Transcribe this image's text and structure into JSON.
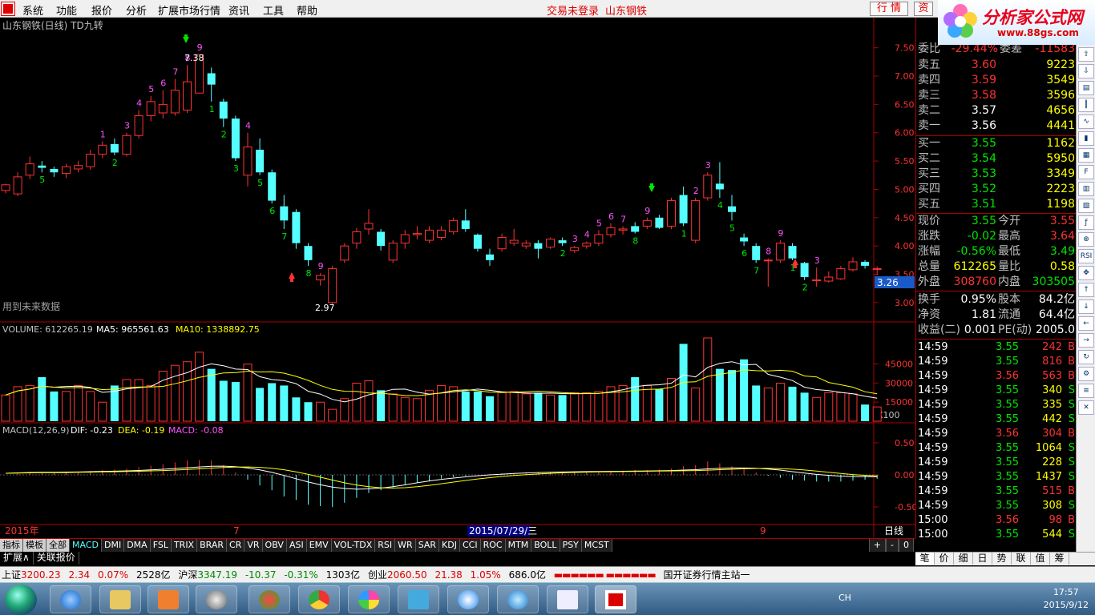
{
  "menu": {
    "items": [
      "系统",
      "功能",
      "报价",
      "分析",
      "扩展市场行情",
      "资讯",
      "工具",
      "帮助"
    ],
    "status_login": "交易未登录",
    "status_stock": "山东钢铁",
    "btn_quote": "行 情",
    "btn_trade": "资"
  },
  "brand": {
    "name": "分析家公式网",
    "url": "www.88gs.com"
  },
  "price_panel": {
    "title": "山东钢铁(日线) TD九转",
    "future_note": "用到未来数据",
    "y_ticks": [
      "7.50",
      "7.00",
      "6.50",
      "6.00",
      "5.50",
      "5.00",
      "4.50",
      "4.00",
      "3.50",
      "3.00"
    ],
    "current_price_tag": "3.26",
    "high_label": "7.38",
    "low_label": "2.97"
  },
  "volume_panel": {
    "label_vol": "VOLUME: 612265.19",
    "label_ma5": "MA5: 965561.63",
    "label_ma10": "MA10: 1338892.75",
    "y_ticks": [
      "45000",
      "30000",
      "15000"
    ],
    "multiplier": "X100"
  },
  "macd_panel": {
    "label_macd": "MACD(12,26,9)",
    "label_dif": "DIF: -0.23",
    "label_dea": "DEA: -0.19",
    "label_val": "MACD: -0.08",
    "y_ticks": [
      "0.50",
      "0.00",
      "-0.50"
    ]
  },
  "date_axis": {
    "year": "2015年",
    "m7": "7",
    "cursor_date": "2015/07/29/三",
    "m9": "9",
    "period": "日线"
  },
  "chart_data": {
    "type": "candlestick",
    "price_range": [
      2.8,
      7.75
    ],
    "candles": [
      {
        "o": 4.98,
        "c": 5.08,
        "h": 5.1,
        "l": 4.93
      },
      {
        "o": 4.92,
        "c": 5.22,
        "h": 5.3,
        "l": 4.88
      },
      {
        "o": 5.25,
        "c": 5.45,
        "h": 5.58,
        "l": 5.18
      },
      {
        "o": 5.42,
        "c": 5.38,
        "h": 5.5,
        "l": 5.3
      },
      {
        "o": 5.36,
        "c": 5.3,
        "h": 5.4,
        "l": 5.22
      },
      {
        "o": 5.28,
        "c": 5.4,
        "h": 5.45,
        "l": 5.2
      },
      {
        "o": 5.36,
        "c": 5.42,
        "h": 5.5,
        "l": 5.3
      },
      {
        "o": 5.4,
        "c": 5.62,
        "h": 5.7,
        "l": 5.35
      },
      {
        "o": 5.62,
        "c": 5.78,
        "h": 5.85,
        "l": 5.55
      },
      {
        "o": 5.8,
        "c": 5.65,
        "h": 5.9,
        "l": 5.6
      },
      {
        "o": 5.62,
        "c": 5.95,
        "h": 6.0,
        "l": 5.58
      },
      {
        "o": 5.95,
        "c": 6.3,
        "h": 6.4,
        "l": 5.9
      },
      {
        "o": 6.3,
        "c": 6.55,
        "h": 6.65,
        "l": 6.2
      },
      {
        "o": 6.35,
        "c": 6.5,
        "h": 6.75,
        "l": 6.25
      },
      {
        "o": 6.35,
        "c": 6.75,
        "h": 6.95,
        "l": 6.3
      },
      {
        "o": 6.4,
        "c": 6.9,
        "h": 7.2,
        "l": 6.35
      },
      {
        "o": 6.7,
        "c": 7.38,
        "h": 7.38,
        "l": 6.7
      },
      {
        "o": 7.05,
        "c": 6.85,
        "h": 7.15,
        "l": 6.55
      },
      {
        "o": 6.55,
        "c": 6.25,
        "h": 6.6,
        "l": 6.1
      },
      {
        "o": 6.25,
        "c": 5.55,
        "h": 6.3,
        "l": 5.5
      },
      {
        "o": 5.25,
        "c": 5.75,
        "h": 6.0,
        "l": 5.05
      },
      {
        "o": 5.7,
        "c": 5.3,
        "h": 5.9,
        "l": 5.25
      },
      {
        "o": 5.3,
        "c": 4.8,
        "h": 5.35,
        "l": 4.75
      },
      {
        "o": 4.7,
        "c": 4.45,
        "h": 4.9,
        "l": 4.3
      },
      {
        "o": 4.6,
        "c": 4.05,
        "h": 4.65,
        "l": 3.95
      },
      {
        "o": 4.0,
        "c": 3.75,
        "h": 4.05,
        "l": 3.65
      },
      {
        "o": 3.4,
        "c": 3.48,
        "h": 3.52,
        "l": 3.3
      },
      {
        "o": 3.0,
        "c": 3.6,
        "h": 3.65,
        "l": 2.97
      },
      {
        "o": 3.75,
        "c": 4.0,
        "h": 4.05,
        "l": 3.7
      },
      {
        "o": 4.05,
        "c": 4.25,
        "h": 4.32,
        "l": 3.95
      },
      {
        "o": 4.3,
        "c": 4.4,
        "h": 4.65,
        "l": 4.2
      },
      {
        "o": 4.25,
        "c": 4.0,
        "h": 4.3,
        "l": 3.92
      },
      {
        "o": 3.75,
        "c": 4.05,
        "h": 4.1,
        "l": 3.7
      },
      {
        "o": 4.05,
        "c": 4.2,
        "h": 4.28,
        "l": 3.95
      },
      {
        "o": 4.2,
        "c": 4.22,
        "h": 4.35,
        "l": 4.12
      },
      {
        "o": 4.1,
        "c": 4.28,
        "h": 4.35,
        "l": 4.05
      },
      {
        "o": 4.15,
        "c": 4.28,
        "h": 4.35,
        "l": 4.1
      },
      {
        "o": 4.25,
        "c": 4.45,
        "h": 4.5,
        "l": 4.2
      },
      {
        "o": 4.45,
        "c": 4.3,
        "h": 4.65,
        "l": 4.25
      },
      {
        "o": 4.2,
        "c": 3.95,
        "h": 4.22,
        "l": 3.9
      },
      {
        "o": 3.85,
        "c": 3.75,
        "h": 3.95,
        "l": 3.65
      },
      {
        "o": 3.95,
        "c": 4.15,
        "h": 4.22,
        "l": 3.9
      },
      {
        "o": 4.05,
        "c": 4.1,
        "h": 4.3,
        "l": 4.0
      },
      {
        "o": 4.0,
        "c": 4.05,
        "h": 4.1,
        "l": 3.95
      },
      {
        "o": 4.05,
        "c": 3.95,
        "h": 4.1,
        "l": 3.78
      },
      {
        "o": 3.98,
        "c": 4.12,
        "h": 4.15,
        "l": 3.95
      },
      {
        "o": 4.1,
        "c": 4.05,
        "h": 4.15,
        "l": 4.0
      },
      {
        "o": 3.92,
        "c": 3.97,
        "h": 4.0,
        "l": 3.88
      },
      {
        "o": 4.0,
        "c": 4.05,
        "h": 4.08,
        "l": 3.95
      },
      {
        "o": 4.05,
        "c": 4.2,
        "h": 4.28,
        "l": 4.0
      },
      {
        "o": 4.2,
        "c": 4.32,
        "h": 4.4,
        "l": 4.15
      },
      {
        "o": 4.28,
        "c": 4.3,
        "h": 4.35,
        "l": 4.2
      },
      {
        "o": 4.35,
        "c": 4.25,
        "h": 4.42,
        "l": 4.22
      },
      {
        "o": 4.35,
        "c": 4.45,
        "h": 4.5,
        "l": 4.3
      },
      {
        "o": 4.5,
        "c": 4.32,
        "h": 4.55,
        "l": 4.3
      },
      {
        "o": 4.35,
        "c": 4.8,
        "h": 4.85,
        "l": 4.3
      },
      {
        "o": 4.9,
        "c": 4.4,
        "h": 5.05,
        "l": 4.35
      },
      {
        "o": 4.1,
        "c": 4.8,
        "h": 4.85,
        "l": 4.05
      },
      {
        "o": 4.85,
        "c": 5.25,
        "h": 5.3,
        "l": 4.8
      },
      {
        "o": 5.1,
        "c": 5.0,
        "h": 5.48,
        "l": 4.85
      },
      {
        "o": 4.7,
        "c": 4.6,
        "h": 4.9,
        "l": 4.45
      },
      {
        "o": 4.15,
        "c": 4.08,
        "h": 4.22,
        "l": 4.0
      },
      {
        "o": 4.0,
        "c": 3.75,
        "h": 4.05,
        "l": 3.7
      },
      {
        "o": 3.75,
        "c": 3.75,
        "h": 3.78,
        "l": 3.28
      },
      {
        "o": 3.75,
        "c": 4.05,
        "h": 4.1,
        "l": 3.7
      },
      {
        "o": 4.0,
        "c": 3.78,
        "h": 4.05,
        "l": 3.75
      },
      {
        "o": 3.7,
        "c": 3.45,
        "h": 3.72,
        "l": 3.4
      },
      {
        "o": 3.4,
        "c": 3.4,
        "h": 3.62,
        "l": 3.28
      },
      {
        "o": 3.38,
        "c": 3.45,
        "h": 3.55,
        "l": 3.35
      },
      {
        "o": 3.42,
        "c": 3.6,
        "h": 3.65,
        "l": 3.4
      },
      {
        "o": 3.58,
        "c": 3.72,
        "h": 3.8,
        "l": 3.55
      },
      {
        "o": 3.72,
        "c": 3.65,
        "h": 3.75,
        "l": 3.6
      },
      {
        "o": 3.6,
        "c": 3.6,
        "h": 3.64,
        "l": 3.49
      }
    ],
    "td_counts": [
      {
        "i": 3,
        "n": "5"
      },
      {
        "i": 8,
        "n": "1"
      },
      {
        "i": 9,
        "n": "2"
      },
      {
        "i": 10,
        "n": "3"
      },
      {
        "i": 11,
        "n": "4"
      },
      {
        "i": 12,
        "n": "5"
      },
      {
        "i": 13,
        "n": "6"
      },
      {
        "i": 14,
        "n": "7"
      },
      {
        "i": 15,
        "n": "8"
      },
      {
        "i": 16,
        "n": "9"
      },
      {
        "i": 17,
        "n": "1"
      },
      {
        "i": 18,
        "n": "2"
      },
      {
        "i": 19,
        "n": "3"
      },
      {
        "i": 20,
        "n": "4"
      },
      {
        "i": 21,
        "n": "5"
      },
      {
        "i": 22,
        "n": "6"
      },
      {
        "i": 23,
        "n": "7"
      },
      {
        "i": 25,
        "n": "8"
      },
      {
        "i": 26,
        "n": "9"
      },
      {
        "i": 46,
        "n": "2"
      },
      {
        "i": 47,
        "n": "3"
      },
      {
        "i": 48,
        "n": "4"
      },
      {
        "i": 49,
        "n": "5"
      },
      {
        "i": 50,
        "n": "6"
      },
      {
        "i": 51,
        "n": "7"
      },
      {
        "i": 52,
        "n": "8"
      },
      {
        "i": 53,
        "n": "9"
      },
      {
        "i": 56,
        "n": "1"
      },
      {
        "i": 57,
        "n": "2"
      },
      {
        "i": 58,
        "n": "3"
      },
      {
        "i": 59,
        "n": "4"
      },
      {
        "i": 60,
        "n": "5"
      },
      {
        "i": 61,
        "n": "6"
      },
      {
        "i": 62,
        "n": "7"
      },
      {
        "i": 63,
        "n": "8"
      },
      {
        "i": 64,
        "n": "9"
      },
      {
        "i": 65,
        "n": "1"
      },
      {
        "i": 66,
        "n": "2"
      },
      {
        "i": 67,
        "n": "3"
      }
    ],
    "volume": [
      220,
      290,
      300,
      370,
      250,
      250,
      300,
      250,
      160,
      300,
      350,
      350,
      300,
      420,
      470,
      500,
      580,
      440,
      340,
      330,
      480,
      280,
      320,
      300,
      200,
      160,
      160,
      100,
      190,
      320,
      340,
      260,
      230,
      200,
      190,
      260,
      300,
      290,
      250,
      250,
      210,
      240,
      250,
      230,
      240,
      220,
      220,
      240,
      240,
      250,
      290,
      300,
      370,
      300,
      270,
      360,
      650,
      280,
      700,
      440,
      430,
      520,
      300,
      280,
      320,
      290,
      240,
      200,
      240,
      240,
      230,
      140,
      120
    ],
    "macd": [
      0.0,
      0.03,
      0.06,
      0.05,
      0.05,
      0.06,
      0.07,
      0.08,
      0.1,
      0.11,
      0.13,
      0.16,
      0.19,
      0.22,
      0.26,
      0.3,
      0.31,
      0.3,
      0.2,
      0.05,
      -0.1,
      -0.22,
      -0.32,
      -0.45,
      -0.52,
      -0.62,
      -0.65,
      -0.67,
      -0.58,
      -0.48,
      -0.38,
      -0.32,
      -0.26,
      -0.2,
      -0.16,
      -0.12,
      -0.08,
      -0.05,
      -0.02,
      0.0,
      0.02,
      0.03,
      0.04,
      0.05,
      0.06,
      0.06,
      0.07,
      0.07,
      0.07,
      0.07,
      0.08,
      0.09,
      0.1,
      0.1,
      0.11,
      0.13,
      0.18,
      0.2,
      0.28,
      0.24,
      0.18,
      0.12,
      0.05,
      -0.02,
      -0.06,
      -0.1,
      -0.12,
      -0.14,
      -0.14,
      -0.14,
      -0.12,
      -0.1,
      -0.08
    ]
  },
  "quote": {
    "weibi_label": "委比",
    "weibi_val": "-29.44%",
    "weicha_label": "委差",
    "weicha_val": "-11583",
    "asks": [
      {
        "label": "卖五",
        "price": "3.60",
        "vol": "9223"
      },
      {
        "label": "卖四",
        "price": "3.59",
        "vol": "3549"
      },
      {
        "label": "卖三",
        "price": "3.58",
        "vol": "3596"
      },
      {
        "label": "卖二",
        "price": "3.57",
        "vol": "4656"
      },
      {
        "label": "卖一",
        "price": "3.56",
        "vol": "4441"
      }
    ],
    "bids": [
      {
        "label": "买一",
        "price": "3.55",
        "vol": "1162"
      },
      {
        "label": "买二",
        "price": "3.54",
        "vol": "5950"
      },
      {
        "label": "买三",
        "price": "3.53",
        "vol": "3349"
      },
      {
        "label": "买四",
        "price": "3.52",
        "vol": "2223"
      },
      {
        "label": "买五",
        "price": "3.51",
        "vol": "1198"
      }
    ],
    "stats": [
      {
        "l1": "现价",
        "v1": "3.55",
        "l2": "今开",
        "v2": "3.55"
      },
      {
        "l1": "涨跌",
        "v1": "-0.02",
        "l2": "最高",
        "v2": "3.64"
      },
      {
        "l1": "涨幅",
        "v1": "-0.56%",
        "l2": "最低",
        "v2": "3.49"
      },
      {
        "l1": "总量",
        "v1": "612265",
        "l2": "量比",
        "v2": "0.58"
      },
      {
        "l1": "外盘",
        "v1": "308760",
        "l2": "内盘",
        "v2": "303505"
      },
      {
        "l1": "换手",
        "v1": "0.95%",
        "l2": "股本",
        "v2": "84.2亿"
      },
      {
        "l1": "净资",
        "v1": "1.81",
        "l2": "流通",
        "v2": "64.4亿"
      },
      {
        "l1": "收益(二)",
        "v1": "0.001",
        "l2": "PE(动)",
        "v2": "2005.0"
      }
    ],
    "ticks": [
      {
        "t": "14:59",
        "p": "3.55",
        "v": "242",
        "s": "B"
      },
      {
        "t": "14:59",
        "p": "3.55",
        "v": "816",
        "s": "B"
      },
      {
        "t": "14:59",
        "p": "3.56",
        "v": "563",
        "s": "B"
      },
      {
        "t": "14:59",
        "p": "3.55",
        "v": "340",
        "s": "S"
      },
      {
        "t": "14:59",
        "p": "3.55",
        "v": "335",
        "s": "S"
      },
      {
        "t": "14:59",
        "p": "3.55",
        "v": "442",
        "s": "S"
      },
      {
        "t": "14:59",
        "p": "3.56",
        "v": "304",
        "s": "B"
      },
      {
        "t": "14:59",
        "p": "3.55",
        "v": "1064",
        "s": "S"
      },
      {
        "t": "14:59",
        "p": "3.55",
        "v": "228",
        "s": "S"
      },
      {
        "t": "14:59",
        "p": "3.55",
        "v": "1437",
        "s": "S"
      },
      {
        "t": "14:59",
        "p": "3.55",
        "v": "515",
        "s": "B"
      },
      {
        "t": "14:59",
        "p": "3.55",
        "v": "308",
        "s": "S"
      },
      {
        "t": "15:00",
        "p": "3.56",
        "v": "98",
        "s": "B"
      },
      {
        "t": "15:00",
        "p": "3.55",
        "v": "544",
        "s": "S"
      }
    ]
  },
  "tabs": {
    "groups": [
      "指标",
      "模板",
      "全部"
    ],
    "items": [
      "MACD",
      "DMI",
      "DMA",
      "FSL",
      "TRIX",
      "BRAR",
      "CR",
      "VR",
      "OBV",
      "ASI",
      "EMV",
      "VOL-TDX",
      "RSI",
      "WR",
      "SAR",
      "KDJ",
      "CCI",
      "ROC",
      "MTM",
      "BOLL",
      "PSY",
      "MCST"
    ],
    "ctrl": [
      "+",
      "-",
      "0"
    ]
  },
  "sub_tabs": [
    "扩展∧",
    "关联报价"
  ],
  "right_tabs": [
    "笔",
    "价",
    "细",
    "日",
    "势",
    "联",
    "值",
    "筹"
  ],
  "status": {
    "sh_name": "上证",
    "sh_val": "3200.23",
    "sh_chg": "2.34",
    "sh_pct": "0.07%",
    "sh_amt": "2528亿",
    "hs_name": "沪深",
    "hs_val": "3347.19",
    "hs_chg": "-10.37",
    "hs_pct": "-0.31%",
    "hs_amt": "1303亿",
    "cy_name": "创业",
    "cy_val": "2060.50",
    "cy_chg": "21.38",
    "cy_pct": "1.05%",
    "cy_amt": "686.0亿",
    "station": "国开证券行情主站一"
  },
  "taskbar": {
    "lang": "CH",
    "time": "17:57",
    "date": "2015/9/12"
  },
  "colors": {
    "up": "#ff3232",
    "down": "#55ffff",
    "ma5": "#ffffff",
    "ma10": "#ffff00",
    "buy_arrow": "#ff3232",
    "sell_arrow": "#00e600"
  }
}
